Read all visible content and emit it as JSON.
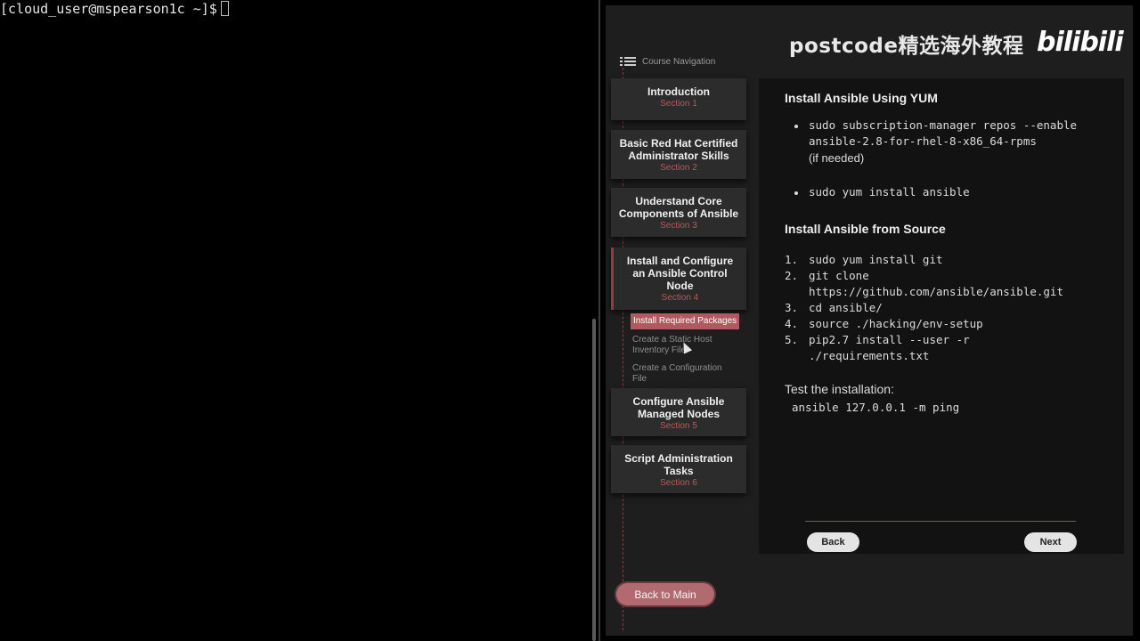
{
  "terminal": {
    "prompt": "[cloud_user@mspearson1c ~]$"
  },
  "watermark": {
    "text": "postcode精选海外教程",
    "logo": "bilibili"
  },
  "nav": {
    "header": "Course Navigation",
    "icon": "list-icon",
    "sections": [
      {
        "title": "Introduction",
        "subtitle": "Section 1"
      },
      {
        "title": "Basic Red Hat Certified Administrator Skills",
        "subtitle": "Section 2"
      },
      {
        "title": "Understand Core Components of Ansible",
        "subtitle": "Section 3"
      },
      {
        "title": "Install and Configure an Ansible Control Node",
        "subtitle": "Section 4"
      },
      {
        "title": "Configure Ansible Managed Nodes",
        "subtitle": "Section 5"
      },
      {
        "title": "Script Administration Tasks",
        "subtitle": "Section 6"
      }
    ],
    "subitems": [
      {
        "label": "Install Required Packages",
        "selected": true
      },
      {
        "label": "Create a Static Host Inventory File",
        "selected": false
      },
      {
        "label": "Create a Configuration File",
        "selected": false
      }
    ],
    "back_to_main": "Back to Main"
  },
  "content": {
    "heading1": "Install Ansible Using YUM",
    "yum_bullets": [
      {
        "line1": "sudo subscription-manager repos --enable",
        "line2": "ansible-2.8-for-rhel-8-x86_64-rpms",
        "note": "(if needed)"
      },
      {
        "line1": "sudo yum install ansible"
      }
    ],
    "heading2": "Install Ansible from Source",
    "steps": [
      {
        "num": "1.",
        "line1": "sudo yum install git"
      },
      {
        "num": "2.",
        "line1": "git clone",
        "line2": "https://github.com/ansible/ansible.git"
      },
      {
        "num": "3.",
        "line1": "cd ansible/"
      },
      {
        "num": "4.",
        "line1": "source ./hacking/env-setup"
      },
      {
        "num": "5.",
        "line1": "pip2.7 install --user -r",
        "line2": "./requirements.txt"
      }
    ],
    "test_label": "Test the installation:",
    "test_command": "ansible 127.0.0.1 -m ping",
    "back_label": "Back",
    "next_label": "Next"
  },
  "colors": {
    "accent": "#b05a60",
    "section_subtitle": "#b85a5a",
    "panel": "#121212"
  }
}
